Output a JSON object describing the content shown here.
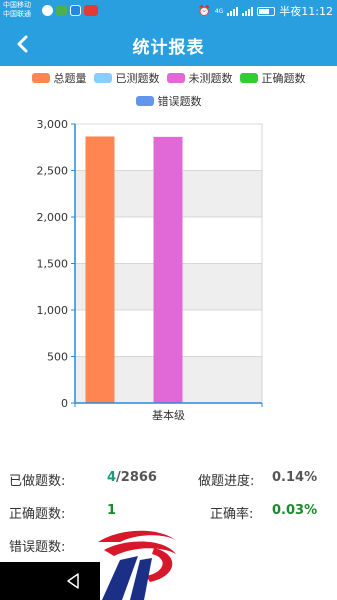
{
  "status_bar": {
    "carrier_1": "中国移动",
    "carrier_2": "中国联通",
    "time": "半夜11:12",
    "network": "4G"
  },
  "header": {
    "title": "统计报表"
  },
  "legend": [
    {
      "label": "总题量",
      "color": "#ff8552"
    },
    {
      "label": "已测题数",
      "color": "#87ceff"
    },
    {
      "label": "未测题数",
      "color": "#e069d6"
    },
    {
      "label": "正确题数",
      "color": "#33cc33"
    },
    {
      "label": "错误题数",
      "color": "#6495ed"
    }
  ],
  "chart_data": {
    "type": "bar",
    "categories": [
      "基本级"
    ],
    "series": [
      {
        "name": "总题量",
        "values": [
          2866
        ]
      },
      {
        "name": "已测题数",
        "values": [
          4
        ]
      },
      {
        "name": "未测题数",
        "values": [
          2862
        ]
      },
      {
        "name": "正确题数",
        "values": [
          1
        ]
      },
      {
        "name": "错误题数",
        "values": [
          3
        ]
      }
    ],
    "ylim": [
      0,
      3000
    ],
    "yticks": [
      "0",
      "500",
      "1,000",
      "1,500",
      "2,000",
      "2,500",
      "3,000"
    ],
    "grid": true
  },
  "stats": {
    "done_label": "已做题数:",
    "done_value": "4",
    "total_value": "/2866",
    "progress_label": "做题进度:",
    "progress_value": "0.14%",
    "correct_label": "正确题数:",
    "correct_value": "1",
    "rate_label": "正确率:",
    "rate_value": "0.03%",
    "wrong_label": "错误题数:"
  }
}
